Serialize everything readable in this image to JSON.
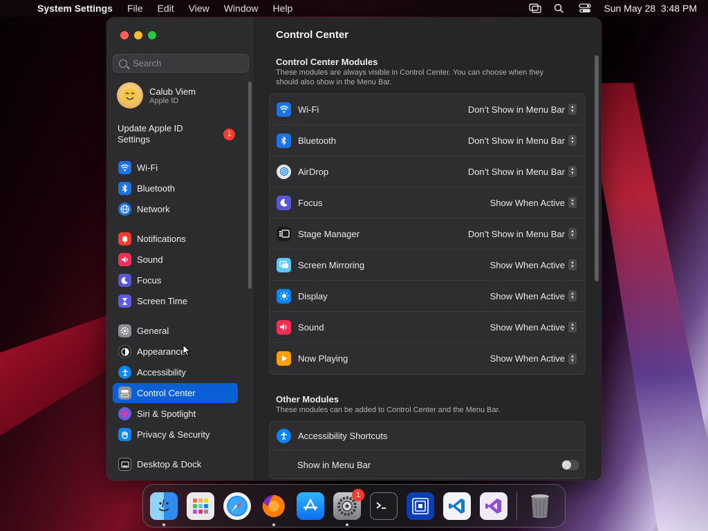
{
  "menubar": {
    "app": "System Settings",
    "items": [
      "File",
      "Edit",
      "View",
      "Window",
      "Help"
    ],
    "clock": "Sun May 28  3:48 PM"
  },
  "sidebar": {
    "search_placeholder": "Search",
    "profile": {
      "name": "Calub Viem",
      "sub": "Apple ID"
    },
    "update": {
      "label": "Update Apple ID Settings",
      "badge": "1"
    },
    "items": [
      {
        "label": "Wi-Fi",
        "icon": "wifi-icon",
        "color": "#1a73e8"
      },
      {
        "label": "Bluetooth",
        "icon": "bluetooth-icon",
        "color": "#1a73e8"
      },
      {
        "label": "Network",
        "icon": "globe-icon",
        "color": "#1a73e8"
      },
      {
        "label": "Notifications",
        "icon": "bell-icon",
        "color": "#ff3b30"
      },
      {
        "label": "Sound",
        "icon": "speaker-icon",
        "color": "#ff2d55"
      },
      {
        "label": "Focus",
        "icon": "moon-icon",
        "color": "#5856d6"
      },
      {
        "label": "Screen Time",
        "icon": "hourglass-icon",
        "color": "#5e5ce6"
      },
      {
        "label": "General",
        "icon": "gear-icon",
        "color": "#8e8e93"
      },
      {
        "label": "Appearance",
        "icon": "appearance-icon",
        "color": "#1c1c1e"
      },
      {
        "label": "Accessibility",
        "icon": "accessibility-icon",
        "color": "#0a84ff"
      },
      {
        "label": "Control Center",
        "icon": "control-center-icon",
        "color": "#8e8e93"
      },
      {
        "label": "Siri & Spotlight",
        "icon": "siri-icon",
        "color": "#af52de"
      },
      {
        "label": "Privacy & Security",
        "icon": "hand-icon",
        "color": "#0a84ff"
      },
      {
        "label": "Desktop & Dock",
        "icon": "dock-icon",
        "color": "#1c1c1e"
      }
    ],
    "active": "Control Center"
  },
  "content": {
    "title": "Control Center",
    "modules": {
      "title": "Control Center Modules",
      "desc": "These modules are always visible in Control Center. You can choose when they should also show in the Menu Bar.",
      "rows": [
        {
          "label": "Wi-Fi",
          "value": "Don’t Show in Menu Bar",
          "icon": "wifi-icon",
          "color": "#1a73e8"
        },
        {
          "label": "Bluetooth",
          "value": "Don’t Show in Menu Bar",
          "icon": "bluetooth-icon",
          "color": "#1a73e8"
        },
        {
          "label": "AirDrop",
          "value": "Don’t Show in Menu Bar",
          "icon": "airdrop-icon",
          "color": "#e5e5ea"
        },
        {
          "label": "Focus",
          "value": "Show When Active",
          "icon": "moon-icon",
          "color": "#5856d6"
        },
        {
          "label": "Stage Manager",
          "value": "Don’t Show in Menu Bar",
          "icon": "stage-manager-icon",
          "color": "#1c1c1e"
        },
        {
          "label": "Screen Mirroring",
          "value": "Show When Active",
          "icon": "screen-mirroring-icon",
          "color": "#5ac8fa"
        },
        {
          "label": "Display",
          "value": "Show When Active",
          "icon": "sun-icon",
          "color": "#0a84ff"
        },
        {
          "label": "Sound",
          "value": "Show When Active",
          "icon": "speaker-icon",
          "color": "#ff2d55"
        },
        {
          "label": "Now Playing",
          "value": "Show When Active",
          "icon": "play-icon",
          "color": "#ff9f0a"
        }
      ]
    },
    "other": {
      "title": "Other Modules",
      "desc": "These modules can be added to Control Center and the Menu Bar.",
      "rows": [
        {
          "label": "Accessibility Shortcuts",
          "icon": "accessibility-icon",
          "color": "#0a84ff"
        },
        {
          "label": "Show in Menu Bar",
          "toggle": false
        }
      ]
    }
  },
  "dock": {
    "apps": [
      {
        "name": "finder-icon",
        "running": true
      },
      {
        "name": "launchpad-icon",
        "running": false
      },
      {
        "name": "safari-icon",
        "running": false
      },
      {
        "name": "firefox-icon",
        "running": true
      },
      {
        "name": "app-store-icon",
        "running": false
      },
      {
        "name": "system-settings-icon",
        "running": true,
        "badge": "1"
      },
      {
        "name": "terminal-icon",
        "running": false
      },
      {
        "name": "remote-desktop-icon",
        "running": false
      },
      {
        "name": "vscode-icon",
        "running": false
      },
      {
        "name": "visual-studio-icon",
        "running": false
      }
    ],
    "trash": "trash-icon"
  }
}
